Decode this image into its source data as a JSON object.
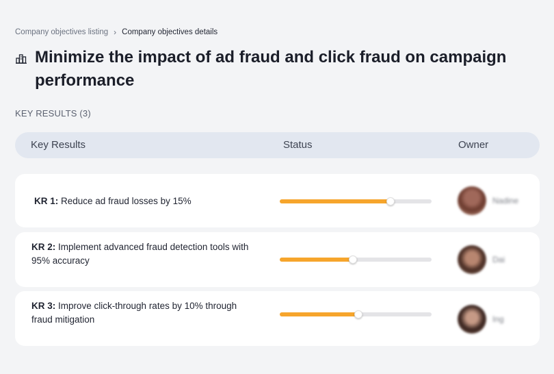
{
  "breadcrumb": {
    "parent": "Company objectives listing",
    "separator": "›",
    "current": "Company objectives details"
  },
  "objective": {
    "icon": "building-chart-icon",
    "title": "Minimize the impact of ad fraud and click fraud on campaign performance"
  },
  "key_results_label": "KEY RESULTS (3)",
  "table": {
    "headers": {
      "key_results": "Key Results",
      "status": "Status",
      "owner": "Owner"
    }
  },
  "key_results": [
    {
      "id": "KR 1:",
      "text": " Reduce ad fraud losses by 15%",
      "progress": 0.73,
      "owner": "Nadine"
    },
    {
      "id": "KR 2:",
      "text": " Implement advanced fraud detection tools with 95% accuracy",
      "progress": 0.48,
      "owner": "Dai"
    },
    {
      "id": "KR 3:",
      "text": " Improve click-through rates by 10% through fraud mitigation",
      "progress": 0.52,
      "owner": "Ing"
    }
  ],
  "colors": {
    "progress_fill": "#f6a52c",
    "progress_track": "#e4e4e7",
    "background": "#f3f4f6",
    "header_bg": "#e2e7f0"
  }
}
